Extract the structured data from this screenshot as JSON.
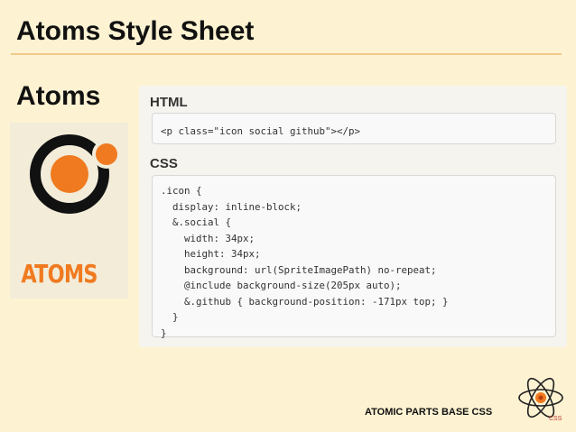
{
  "slide": {
    "title": "Atoms Style Sheet",
    "section_title": "Atoms"
  },
  "logo": {
    "text": "ATOMS",
    "colors": {
      "ring": "#111111",
      "core": "#f07a1f",
      "text": "#f07a1f"
    }
  },
  "html_section": {
    "heading": "HTML",
    "code": "<p class=\"icon social github\"></p>"
  },
  "css_section": {
    "heading": "CSS",
    "code_lines": [
      ".icon {",
      "  display: inline-block;",
      "  &.social {",
      "    width: 34px;",
      "    height: 34px;",
      "    background: url(SpriteImagePath) no-repeat;",
      "    @include background-size(205px auto);",
      "    &.github { background-position: -171px top; }",
      "  }",
      "}"
    ]
  },
  "footer": {
    "text": "ATOMIC PARTS BASE CSS",
    "icon_label": "CSS",
    "icon": "atom-icon"
  },
  "colors": {
    "background": "#fdf3d2",
    "accent": "#f07a1f",
    "rule": "#f1c98a"
  }
}
